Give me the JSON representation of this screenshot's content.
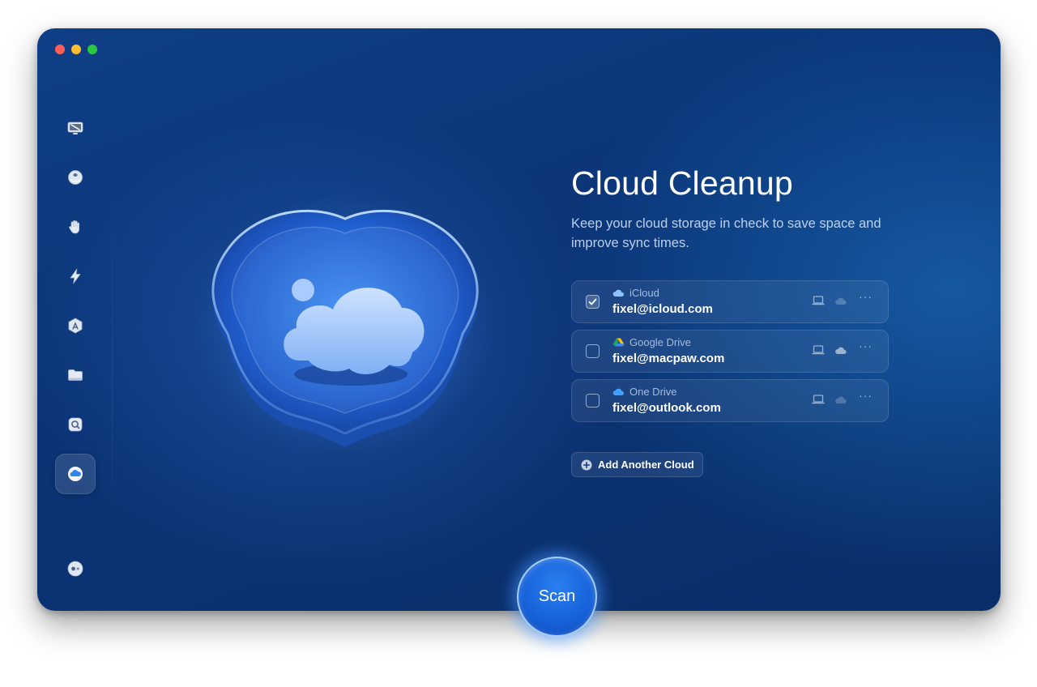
{
  "window": {
    "traffic_lights": [
      "close",
      "minimize",
      "zoom"
    ]
  },
  "sidebar": {
    "items": [
      {
        "name": "smart-scan",
        "icon": "monitor-broom-icon",
        "active": false
      },
      {
        "name": "protection",
        "icon": "shield-ball-icon",
        "active": false
      },
      {
        "name": "privacy",
        "icon": "hand-icon",
        "active": false
      },
      {
        "name": "performance",
        "icon": "lightning-icon",
        "active": false
      },
      {
        "name": "applications",
        "icon": "app-store-icon",
        "active": false
      },
      {
        "name": "my-clutter",
        "icon": "folder-icon",
        "active": false
      },
      {
        "name": "space-lens",
        "icon": "magnifier-icon",
        "active": false
      },
      {
        "name": "cloud-cleanup",
        "icon": "cloud-icon",
        "active": true
      }
    ],
    "bottom_icon": "assistant-dots-icon"
  },
  "main": {
    "title": "Cloud Cleanup",
    "subtitle": "Keep your cloud storage in check to save space and improve sync times.",
    "clouds": [
      {
        "provider": "iCloud",
        "account": "fixel@icloud.com",
        "checked": true,
        "provider_icon": "icloud-icon"
      },
      {
        "provider": "Google Drive",
        "account": "fixel@macpaw.com",
        "checked": false,
        "provider_icon": "google-drive-icon"
      },
      {
        "provider": "One Drive",
        "account": "fixel@outlook.com",
        "checked": false,
        "provider_icon": "onedrive-icon"
      }
    ],
    "add_button_label": "Add Another Cloud",
    "scan_label": "Scan"
  },
  "colors": {
    "background_dark": "#0a2e69",
    "background_mid": "#0f3f86",
    "accent_blue": "#1660d8",
    "text_primary": "#ffffff"
  }
}
